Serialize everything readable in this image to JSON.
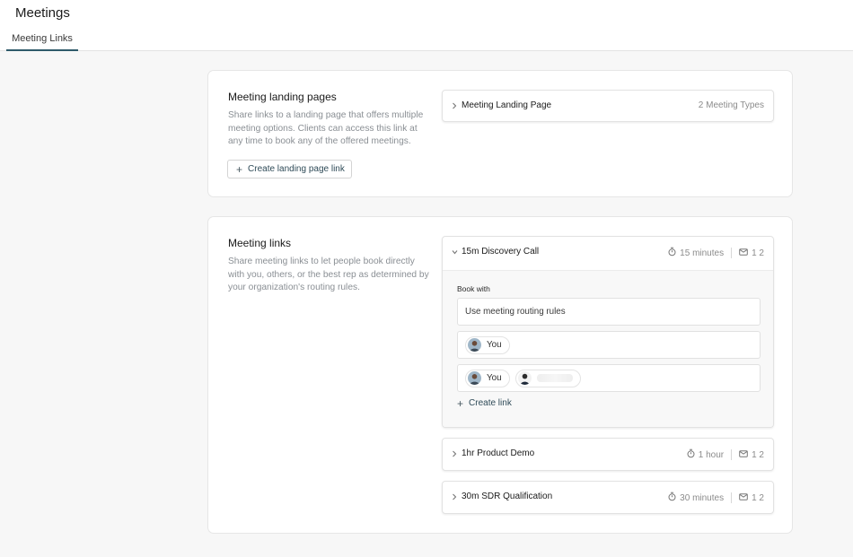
{
  "header": {
    "title": "Meetings",
    "tabs": [
      {
        "label": "Meeting Links",
        "active": true
      }
    ]
  },
  "landing_section": {
    "title": "Meeting landing pages",
    "description": "Share links to a landing page that offers multiple meeting options. Clients can access this link at any time to book any of the offered meetings.",
    "create_button": "Create landing page link",
    "page_row": {
      "title": "Meeting Landing Page",
      "meta": "2 Meeting Types"
    }
  },
  "links_section": {
    "title": "Meeting links",
    "description": "Share meeting links to let people book directly with you, others, or the best rep as determined by your organization's routing rules.",
    "meetings": [
      {
        "title": "15m Discovery Call",
        "duration": "15 minutes",
        "count": "1 2",
        "expanded": true,
        "book_with_label": "Book with",
        "options": [
          {
            "label": "Use meeting routing rules"
          },
          {
            "chips": [
              "You"
            ]
          },
          {
            "chips": [
              "You",
              ""
            ]
          }
        ],
        "create_link_label": "Create link"
      },
      {
        "title": "1hr Product Demo",
        "duration": "1 hour",
        "count": "1 2",
        "expanded": false
      },
      {
        "title": "30m SDR Qualification",
        "duration": "30 minutes",
        "count": "1 2",
        "expanded": false
      }
    ]
  },
  "icons": {
    "chevron_collapsed": "chevron-right-icon",
    "chevron_expanded": "chevron-down-icon",
    "duration": "stopwatch-icon",
    "count": "envelope-icon",
    "add": "plus-icon"
  },
  "colors": {
    "accent": "#2e5a6a",
    "link_text": "#2f4b58",
    "muted_text": "#8a8f94",
    "page_bg": "#f7f7f7"
  }
}
